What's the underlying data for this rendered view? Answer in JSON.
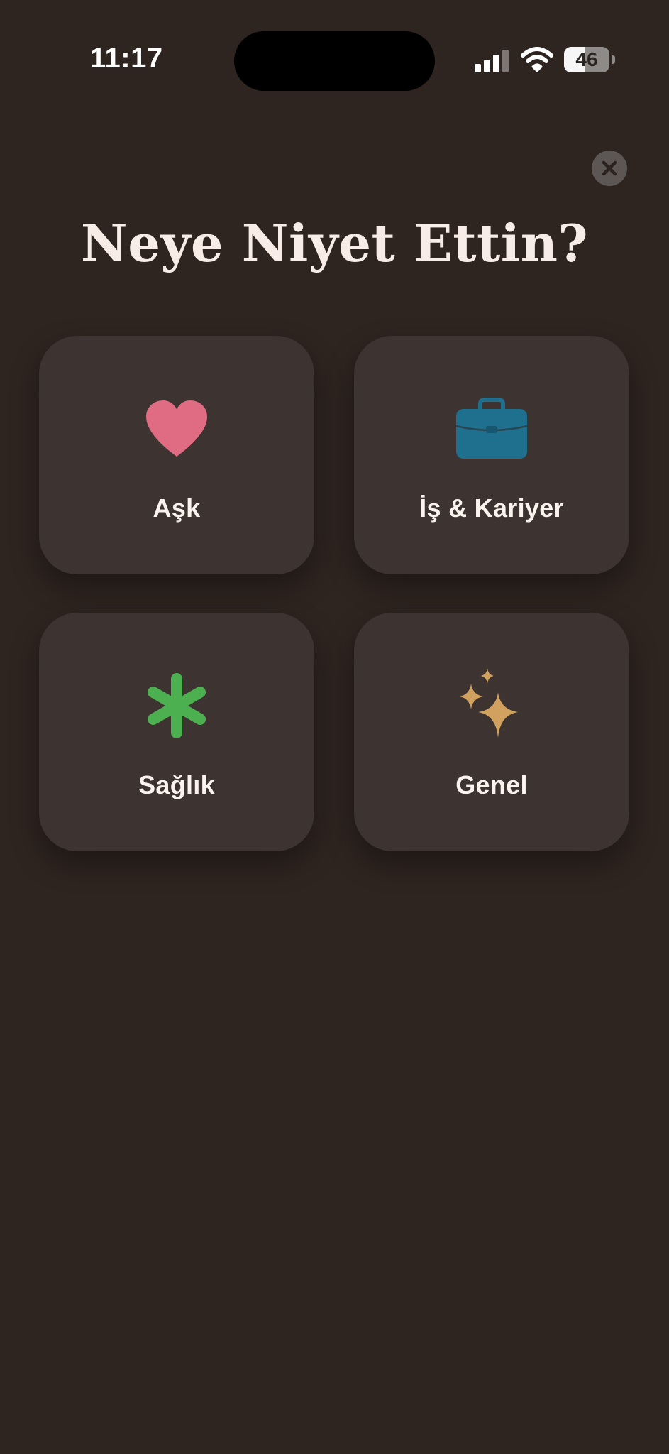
{
  "status_bar": {
    "time": "11:17",
    "battery_level": "46",
    "battery_fraction": 0.46
  },
  "close_button": {
    "icon": "close-icon"
  },
  "title": "Neye Niyet Ettin?",
  "categories": [
    {
      "label": "Aşk",
      "icon": "heart-icon",
      "color": "#e06c84"
    },
    {
      "label": "İş & Kariyer",
      "icon": "briefcase-icon",
      "color": "#1f6f8f"
    },
    {
      "label": "Sağlık",
      "icon": "asterisk-icon",
      "color": "#4caf50"
    },
    {
      "label": "Genel",
      "icon": "sparkles-icon",
      "color": "#d1a25f"
    }
  ],
  "colors": {
    "background": "#2e2420",
    "card": "#3d3330",
    "title": "#f7ede6"
  }
}
